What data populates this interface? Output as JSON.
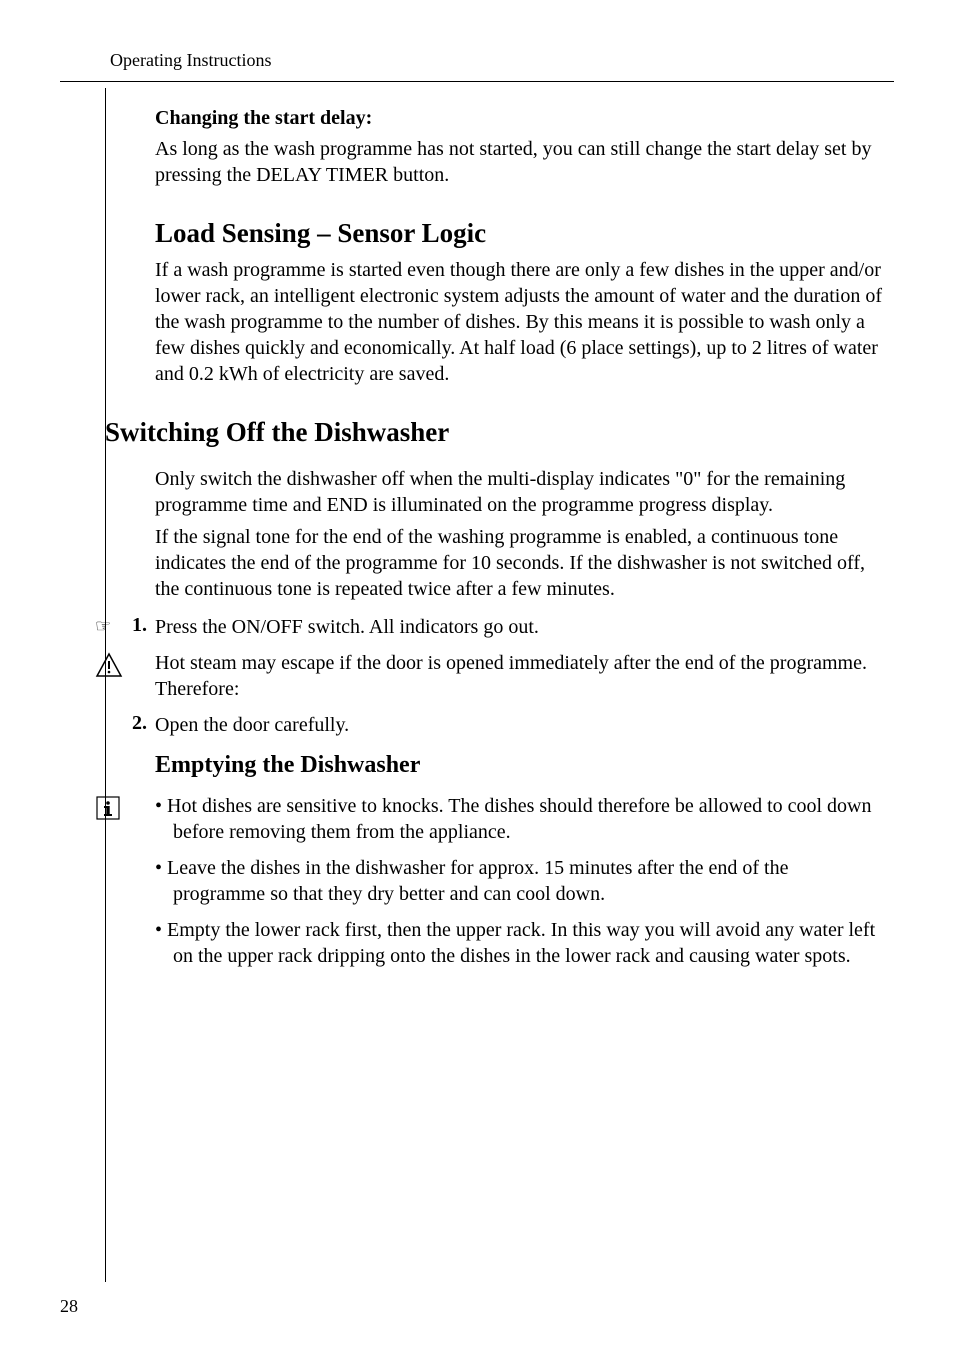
{
  "header": {
    "title": "Operating Instructions"
  },
  "section1": {
    "heading": "Changing the start delay:",
    "body": "As long as the wash programme has not started, you can still change the start delay set by pressing the DELAY TIMER button."
  },
  "section2": {
    "heading": "Load Sensing – Sensor Logic",
    "body": "If a wash programme is started even though there are only a few dishes in the upper and/or lower rack, an intelligent electronic system adjusts the amount of water and the duration of the wash programme to the number of dishes. By this means it is possible to wash only a few dishes quickly and economically. At half load (6 place settings), up to 2 litres of water and 0.2 kWh of electricity are saved."
  },
  "section3": {
    "heading": "Switching Off the Dishwasher",
    "body1": "Only switch the dishwasher off when the multi-display indicates \"0\" for the remaining programme time and END is illuminated on the programme progress display.",
    "body2": "If the signal tone for the end of the washing programme is enabled, a continuous tone indicates the end of the programme for 10 seconds. If the dishwasher is not switched off, the continuous tone is repeated twice after a few minutes.",
    "step1_num": "1.",
    "step1_text": "Press the ON/OFF switch. All indicators go out.",
    "warning_text": "Hot steam may escape if the door is opened immediately after the end of the programme. Therefore:",
    "step2_num": "2.",
    "step2_text": "Open the door carefully."
  },
  "section4": {
    "heading": "Emptying the Dishwasher",
    "bullet1": "Hot dishes are sensitive to knocks. The dishes should therefore be allowed to cool down before removing them from the appliance.",
    "bullet2": "Leave the dishes in the dishwasher for approx. 15 minutes after the end of the programme so that they dry better and can cool down.",
    "bullet3": "Empty the lower rack first, then the upper rack. In this way you will avoid any water left on the upper rack dripping onto the dishes in the lower rack and causing water spots."
  },
  "page_number": "28",
  "icons": {
    "hand": "☞",
    "warning": "warning-icon",
    "info": "info-icon"
  }
}
